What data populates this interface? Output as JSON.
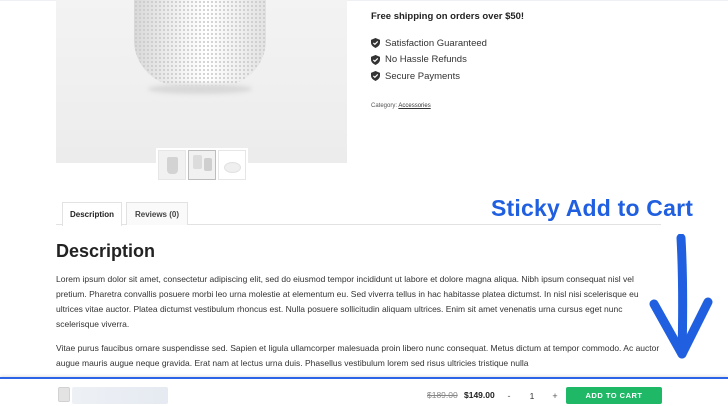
{
  "product": {
    "shipping_note": "Free shipping on orders over $50!",
    "features": [
      {
        "label": "Satisfaction Guaranteed",
        "icon": "shield-check-icon"
      },
      {
        "label": "No Hassle Refunds",
        "icon": "shield-check-icon"
      },
      {
        "label": "Secure Payments",
        "icon": "shield-check-icon"
      }
    ],
    "category_label": "Category:",
    "category_link": "Accessories"
  },
  "tabs": [
    {
      "label": "Description",
      "active": true
    },
    {
      "label": "Reviews (0)",
      "active": false
    }
  ],
  "description": {
    "heading": "Description",
    "paragraph1": "Lorem ipsum dolor sit amet, consectetur adipiscing elit, sed do eiusmod tempor incididunt ut labore et dolore magna aliqua. Nibh ipsum consequat nisl vel pretium. Pharetra convallis posuere morbi leo urna molestie at elementum eu. Sed viverra tellus in hac habitasse platea dictumst. In nisl nisi scelerisque eu ultrices vitae auctor. Platea dictumst vestibulum rhoncus est. Nulla posuere sollicitudin aliquam ultrices. Enim sit amet venenatis urna cursus eget nunc scelerisque viverra.",
    "paragraph2": "Vitae purus faucibus ornare suspendisse sed. Sapien et ligula ullamcorper malesuada proin libero nunc consequat. Metus dictum at tempor commodo. Ac auctor augue mauris augue neque gravida. Erat nam at lectus urna duis. Phasellus vestibulum lorem sed risus ultricies tristique nulla"
  },
  "annotation": {
    "text": "Sticky Add to Cart",
    "color": "#1f5fe0"
  },
  "sticky_bar": {
    "old_price": "$189.00",
    "new_price": "$149.00",
    "qty_minus": "-",
    "qty_value": "1",
    "qty_plus": "+",
    "add_to_cart": "ADD TO CART",
    "button_color": "#1fb866",
    "border_color": "#2d63e6"
  }
}
